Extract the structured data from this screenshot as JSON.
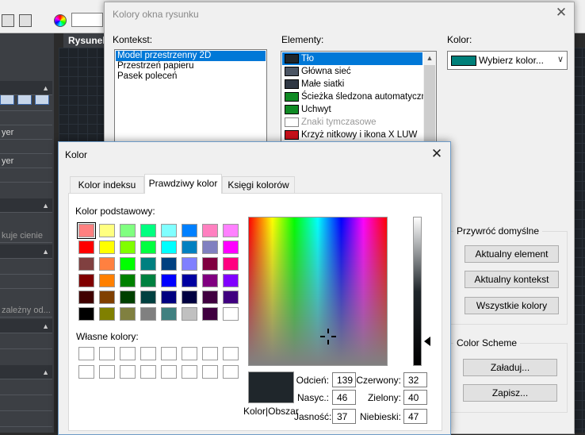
{
  "app": {
    "canvas_tab": "Rysunek",
    "left_panel": [
      "yer",
      "yer",
      "kuje cienie",
      "zależny od..."
    ]
  },
  "main_dialog": {
    "title": "Kolory okna rysunku",
    "context_label": "Kontekst:",
    "contexts": [
      {
        "label": "Model przestrzenny 2D",
        "selected": true
      },
      {
        "label": "Przestrzeń papieru",
        "selected": false
      },
      {
        "label": "Pasek poleceń",
        "selected": false
      }
    ],
    "elements_label": "Elementy:",
    "elements": [
      {
        "label": "Tło",
        "color": "#1f262b",
        "selected": true,
        "dim": false
      },
      {
        "label": "Główna sieć",
        "color": "#4b5563",
        "selected": false,
        "dim": false
      },
      {
        "label": "Małe siatki",
        "color": "#303844",
        "selected": false,
        "dim": false
      },
      {
        "label": "Ścieżka śledzona automatycznie",
        "color": "#0f8a24",
        "selected": false,
        "dim": false
      },
      {
        "label": "Uchwyt",
        "color": "#0f8a24",
        "selected": false,
        "dim": false
      },
      {
        "label": "Znaki tymczasowe",
        "color": "#ffffff",
        "selected": false,
        "dim": true
      },
      {
        "label": "Krzyż nitkowy i ikona X LUW",
        "color": "#c8101a",
        "selected": false,
        "dim": false
      }
    ],
    "color_label": "Kolor:",
    "color_select": {
      "value": "Wybierz kolor...",
      "color": "#00807a"
    },
    "restore_group": {
      "legend": "Przywróć domyślne",
      "buttons": [
        "Aktualny element",
        "Aktualny kontekst",
        "Wszystkie kolory"
      ]
    },
    "scheme_group": {
      "legend": "Color Scheme",
      "buttons": [
        "Załaduj...",
        "Zapisz..."
      ]
    }
  },
  "kolor_dialog": {
    "title": "Kolor",
    "tabs": [
      {
        "label": "Kolor indeksu",
        "active": false
      },
      {
        "label": "Prawdziwy kolor",
        "active": true
      },
      {
        "label": "Księgi kolorów",
        "active": false
      }
    ],
    "basic_label": "Kolor podstawowy:",
    "basic_colors": [
      [
        "#ff8080",
        "#ffff80",
        "#80ff80",
        "#00ff80",
        "#80ffff",
        "#0080ff",
        "#ff80c0",
        "#ff80ff"
      ],
      [
        "#ff0000",
        "#ffff00",
        "#80ff00",
        "#00ff40",
        "#00ffff",
        "#0080c0",
        "#8080c0",
        "#ff00ff"
      ],
      [
        "#804040",
        "#ff8040",
        "#00ff00",
        "#008080",
        "#004080",
        "#8080ff",
        "#800040",
        "#ff0080"
      ],
      [
        "#800000",
        "#ff8000",
        "#008000",
        "#008040",
        "#0000ff",
        "#0000a0",
        "#800080",
        "#8000ff"
      ],
      [
        "#400000",
        "#804000",
        "#004000",
        "#004040",
        "#000080",
        "#000040",
        "#400040",
        "#400080"
      ],
      [
        "#000000",
        "#808000",
        "#808040",
        "#808080",
        "#408080",
        "#c0c0c0",
        "#400040",
        "#ffffff"
      ]
    ],
    "custom_label": "Własne kolory:",
    "preview_label": "Kolor|Obszar",
    "preview_color": "#1f262b",
    "fields": {
      "hue": {
        "label": "Odcień:",
        "value": "139"
      },
      "sat": {
        "label": "Nasyc.:",
        "value": "46"
      },
      "lum": {
        "label": "Jasność:",
        "value": "37"
      },
      "red": {
        "label": "Czerwony:",
        "value": "32"
      },
      "green": {
        "label": "Zielony:",
        "value": "40"
      },
      "blue": {
        "label": "Niebieski:",
        "value": "47"
      }
    }
  }
}
